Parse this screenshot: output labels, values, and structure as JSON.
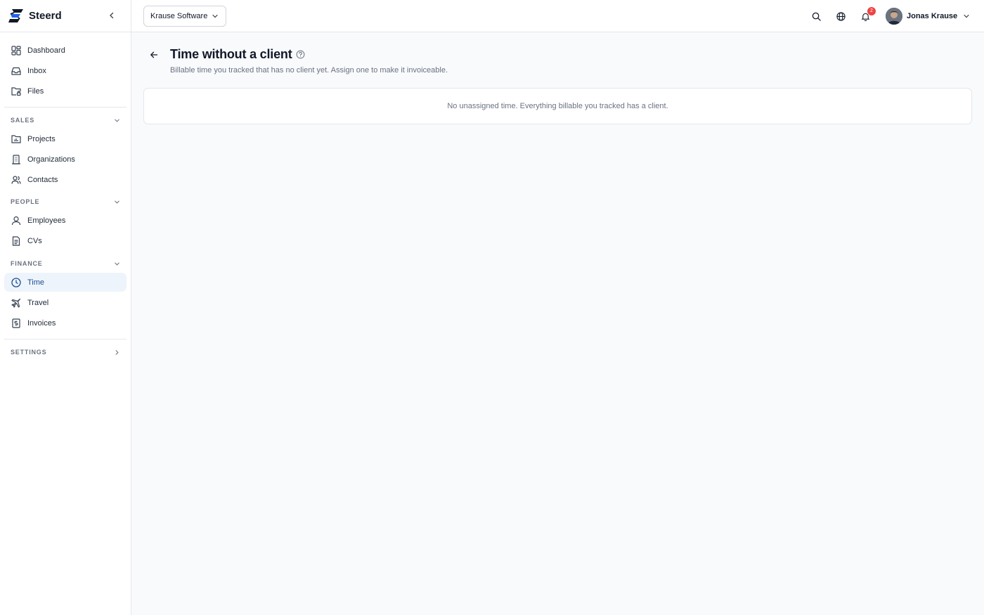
{
  "app": {
    "name": "Steerd"
  },
  "sidebar": {
    "main_items": [
      {
        "label": "Dashboard",
        "icon": "dashboard-icon"
      },
      {
        "label": "Inbox",
        "icon": "inbox-icon"
      },
      {
        "label": "Files",
        "icon": "folder-lock-icon"
      }
    ],
    "sections": [
      {
        "title": "SALES",
        "expanded": true,
        "items": [
          {
            "label": "Projects",
            "icon": "folder-chart-icon"
          },
          {
            "label": "Organizations",
            "icon": "building-icon"
          },
          {
            "label": "Contacts",
            "icon": "users-icon"
          }
        ]
      },
      {
        "title": "PEOPLE",
        "expanded": true,
        "items": [
          {
            "label": "Employees",
            "icon": "user-icon"
          },
          {
            "label": "CVs",
            "icon": "document-icon"
          }
        ]
      },
      {
        "title": "FINANCE",
        "expanded": true,
        "items": [
          {
            "label": "Time",
            "icon": "clock-icon",
            "active": true
          },
          {
            "label": "Travel",
            "icon": "plane-icon"
          },
          {
            "label": "Invoices",
            "icon": "invoice-icon"
          }
        ]
      },
      {
        "title": "SETTINGS",
        "expanded": false,
        "items": []
      }
    ]
  },
  "topbar": {
    "organization": "Krause Software",
    "notifications_count": "2",
    "user_name": "Jonas Krause"
  },
  "page": {
    "title": "Time without a client",
    "subtitle": "Billable time you tracked that has no client yet. Assign one to make it invoiceable.",
    "empty_message": "No unassigned time. Everything billable you tracked has a client."
  },
  "colors": {
    "accent": "#1d4f91",
    "active_bg": "#eef4fb",
    "badge": "#ef4444",
    "page_bg": "#f8fafc"
  }
}
